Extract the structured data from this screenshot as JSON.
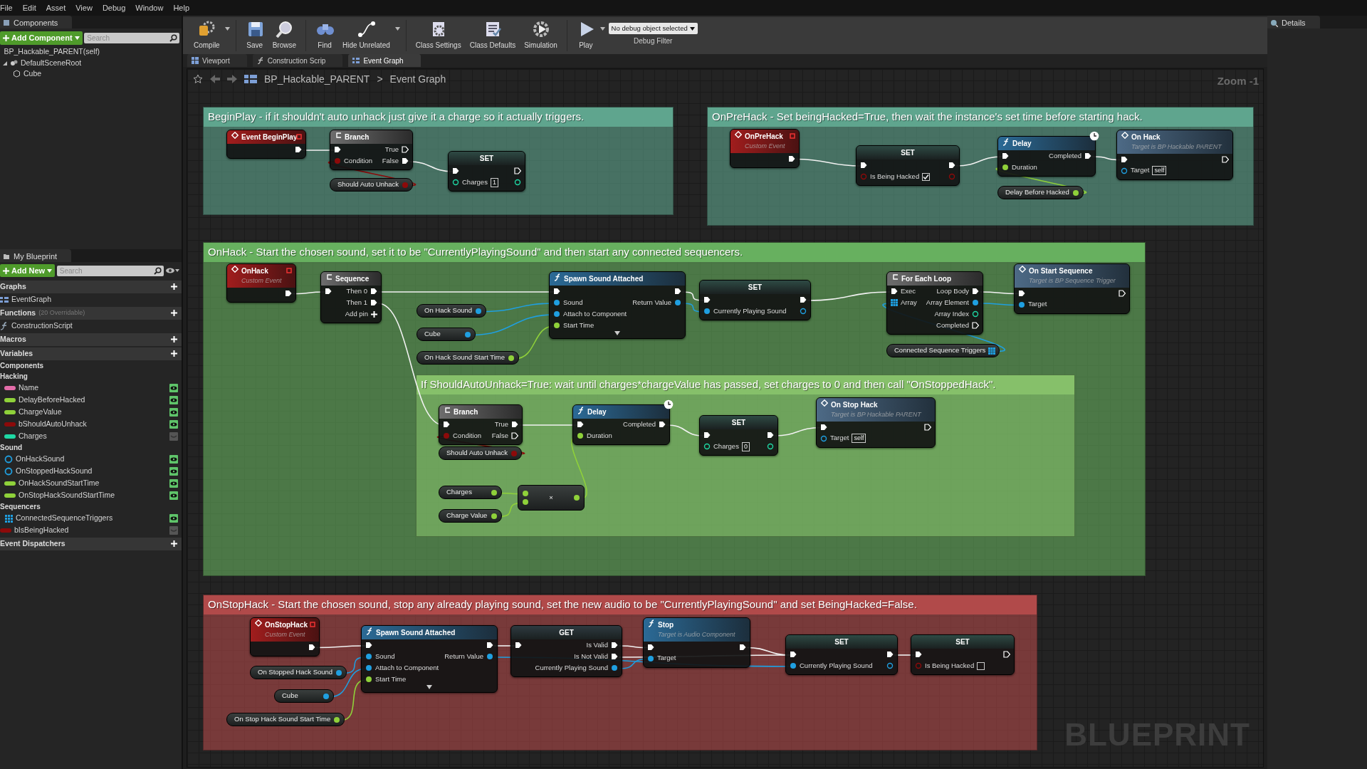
{
  "menu": [
    "File",
    "Edit",
    "Asset",
    "View",
    "Debug",
    "Window",
    "Help"
  ],
  "components_panel": {
    "tab": "Components",
    "add_button": "Add Component",
    "search": {
      "placeholder": "Search"
    },
    "root": "BP_Hackable_PARENT(self)",
    "tree": [
      {
        "label": "DefaultSceneRoot",
        "expanded": true,
        "children": [
          {
            "label": "Cube"
          }
        ]
      }
    ]
  },
  "my_blueprint": {
    "tab": "My Blueprint",
    "add_button": "Add New",
    "search": {
      "placeholder": "Search"
    },
    "sections": [
      {
        "title": "Graphs",
        "items": [
          {
            "kind": "graph",
            "label": "EventGraph"
          }
        ]
      },
      {
        "title": "Functions",
        "note": "(20 Overridable)",
        "items": [
          {
            "kind": "function",
            "label": "ConstructionScript"
          }
        ]
      },
      {
        "title": "Macros"
      },
      {
        "title": "Variables",
        "items": [
          {
            "kind": "category",
            "label": "Components"
          },
          {
            "kind": "category",
            "label": "Hacking",
            "children": [
              {
                "kind": "name",
                "label": "Name",
                "public": true
              },
              {
                "kind": "float",
                "label": "DelayBeforeHacked",
                "public": true
              },
              {
                "kind": "float",
                "label": "ChargeValue",
                "public": true
              },
              {
                "kind": "bool",
                "label": "bShouldAutoUnhack",
                "public": true
              },
              {
                "kind": "int",
                "label": "Charges",
                "public": false
              }
            ]
          },
          {
            "kind": "category",
            "label": "Sound",
            "children": [
              {
                "kind": "object",
                "label": "OnHackSound",
                "public": true
              },
              {
                "kind": "object",
                "label": "OnStoppedHackSound",
                "public": true
              },
              {
                "kind": "float",
                "label": "OnHackSoundStartTime",
                "public": true
              },
              {
                "kind": "float",
                "label": "OnStopHackSoundStartTime",
                "public": true
              }
            ]
          },
          {
            "kind": "category",
            "label": "Sequencers",
            "children": [
              {
                "kind": "array",
                "label": "ConnectedSequenceTriggers",
                "public": true
              }
            ]
          },
          {
            "kind": "bool",
            "label": "bIsBeingHacked",
            "public": false
          }
        ]
      },
      {
        "title": "Event Dispatchers"
      }
    ]
  },
  "toolbar": {
    "buttons": [
      {
        "label": "Compile",
        "dropdown": true
      },
      {
        "label": "Save"
      },
      {
        "label": "Browse"
      },
      {
        "label": "Find"
      },
      {
        "label": "Hide Unrelated",
        "dropdown": true
      },
      {
        "label": "Class Settings"
      },
      {
        "label": "Class Defaults"
      },
      {
        "label": "Simulation"
      },
      {
        "label": "Play",
        "dropdown": true
      }
    ],
    "debug_filter": {
      "value": "No debug object selected",
      "label": "Debug Filter"
    }
  },
  "tabs": [
    {
      "label": "Viewport",
      "selected": false
    },
    {
      "label": "Construction Scrip",
      "selected": false
    },
    {
      "label": "Event Graph",
      "selected": true
    }
  ],
  "breadcrumb": {
    "path": [
      "BP_Hackable_PARENT",
      "Event Graph"
    ],
    "separator": ">"
  },
  "zoom": "Zoom -1",
  "graph": {
    "comments": [
      {
        "title": "BeginPlay - if it shouldn't auto unhack just give it a charge so it actually triggers.",
        "color": "#5fa58e",
        "nodes": [
          {
            "kind": "event",
            "title": "Event BeginPlay",
            "outputs": [
              {
                "kind": "exec",
                "linked": true
              }
            ]
          },
          {
            "kind": "flow",
            "title": "Branch",
            "inputs": [
              {
                "kind": "exec",
                "linked": true
              },
              {
                "kind": "bool",
                "label": "Condition",
                "linked": true
              }
            ],
            "outputs": [
              {
                "kind": "exec",
                "label": "True",
                "linked": false
              },
              {
                "kind": "exec",
                "label": "False",
                "linked": true
              }
            ]
          },
          {
            "kind": "variable",
            "title": "Should Auto Unhack",
            "outputs": [
              {
                "kind": "bool",
                "linked": true
              }
            ]
          },
          {
            "kind": "set",
            "title": "SET",
            "inputs": [
              {
                "kind": "exec",
                "linked": true
              },
              {
                "kind": "int",
                "label": "Charges",
                "linked": false,
                "value": "1"
              }
            ],
            "outputs": [
              {
                "kind": "exec",
                "linked": false
              },
              {
                "kind": "int",
                "linked": false
              }
            ]
          }
        ]
      },
      {
        "title": "OnPreHack - Set beingHacked=True, then wait the instance's set time before starting hack.",
        "color": "#5fa58e",
        "nodes": [
          {
            "kind": "event",
            "title": "OnPreHack",
            "subtitle": "Custom Event",
            "outputs": [
              {
                "kind": "exec",
                "linked": true
              }
            ]
          },
          {
            "kind": "set",
            "title": "SET",
            "inputs": [
              {
                "kind": "exec",
                "linked": true
              },
              {
                "kind": "bool",
                "label": "Is Being Hacked",
                "linked": false,
                "checked": true
              }
            ],
            "outputs": [
              {
                "kind": "exec",
                "linked": true
              },
              {
                "kind": "bool",
                "linked": false
              }
            ]
          },
          {
            "kind": "function",
            "title": "Delay",
            "latent": true,
            "inputs": [
              {
                "kind": "exec",
                "linked": true
              },
              {
                "kind": "float",
                "label": "Duration",
                "linked": true
              }
            ],
            "outputs": [
              {
                "kind": "exec",
                "label": "Completed",
                "linked": true
              }
            ]
          },
          {
            "kind": "variable",
            "title": "Delay Before Hacked",
            "outputs": [
              {
                "kind": "float",
                "linked": true
              }
            ]
          },
          {
            "kind": "message",
            "title": "On Hack",
            "subtitle": "Target is BP Hackable PARENT",
            "inputs": [
              {
                "kind": "exec",
                "linked": true
              },
              {
                "kind": "object",
                "label": "Target",
                "linked": false,
                "value": "self"
              }
            ],
            "outputs": [
              {
                "kind": "exec",
                "linked": false
              }
            ]
          }
        ]
      },
      {
        "title": "OnHack - Start the chosen sound, set it to be \"CurrentlyPlayingSound\" and then start any connected sequencers.",
        "color": "#67b05f",
        "nodes": [
          {
            "kind": "event",
            "title": "OnHack",
            "subtitle": "Custom Event",
            "outputs": [
              {
                "kind": "exec",
                "linked": true
              }
            ]
          },
          {
            "kind": "flow",
            "title": "Sequence",
            "inputs": [
              {
                "kind": "exec",
                "linked": true
              }
            ],
            "outputs": [
              {
                "kind": "exec",
                "label": "Then 0",
                "linked": true
              },
              {
                "kind": "exec",
                "label": "Then 1",
                "linked": true
              },
              {
                "kind": "add",
                "label": "Add pin"
              }
            ]
          },
          {
            "kind": "variable",
            "title": "On Hack Sound",
            "outputs": [
              {
                "kind": "object",
                "linked": true
              }
            ]
          },
          {
            "kind": "variable",
            "title": "Cube",
            "outputs": [
              {
                "kind": "object",
                "linked": true
              }
            ]
          },
          {
            "kind": "variable",
            "title": "On Hack Sound Start Time",
            "outputs": [
              {
                "kind": "float",
                "linked": true
              }
            ]
          },
          {
            "kind": "function",
            "title": "Spawn Sound Attached",
            "advanced": true,
            "inputs": [
              {
                "kind": "exec",
                "linked": true
              },
              {
                "kind": "object",
                "label": "Sound",
                "linked": true
              },
              {
                "kind": "object",
                "label": "Attach to Component",
                "linked": true
              },
              {
                "kind": "float",
                "label": "Start Time",
                "linked": true
              }
            ],
            "outputs": [
              {
                "kind": "exec",
                "linked": true
              },
              {
                "kind": "object",
                "label": "Return Value",
                "linked": true
              }
            ]
          },
          {
            "kind": "set",
            "title": "SET",
            "inputs": [
              {
                "kind": "exec",
                "linked": true
              },
              {
                "kind": "object",
                "label": "Currently Playing Sound",
                "linked": true
              }
            ],
            "outputs": [
              {
                "kind": "exec",
                "linked": true
              },
              {
                "kind": "object",
                "linked": false
              }
            ]
          },
          {
            "kind": "flow",
            "title": "For Each Loop",
            "inputs": [
              {
                "kind": "exec",
                "label": "Exec",
                "linked": true
              },
              {
                "kind": "array",
                "label": "Array",
                "linked": true
              }
            ],
            "outputs": [
              {
                "kind": "exec",
                "label": "Loop Body",
                "linked": true
              },
              {
                "kind": "object",
                "label": "Array Element",
                "linked": true
              },
              {
                "kind": "int",
                "label": "Array Index",
                "linked": false
              },
              {
                "kind": "exec",
                "label": "Completed",
                "linked": false
              }
            ]
          },
          {
            "kind": "variable",
            "title": "Connected Sequence Triggers",
            "outputs": [
              {
                "kind": "array",
                "linked": true
              }
            ]
          },
          {
            "kind": "message",
            "title": "On Start Sequence",
            "subtitle": "Target is BP Sequence Trigger",
            "inputs": [
              {
                "kind": "exec",
                "linked": true
              },
              {
                "kind": "object",
                "label": "Target",
                "linked": true
              }
            ],
            "outputs": [
              {
                "kind": "exec",
                "linked": false
              }
            ]
          }
        ]
      },
      {
        "title": "If ShouldAutoUnhack=True: wait until charges*chargeValue has passed, set charges to 0 and then call \"OnStoppedHack\".",
        "color": "#86c06a",
        "nodes": [
          {
            "kind": "flow",
            "title": "Branch",
            "inputs": [
              {
                "kind": "exec",
                "linked": true
              },
              {
                "kind": "bool",
                "label": "Condition",
                "linked": true
              }
            ],
            "outputs": [
              {
                "kind": "exec",
                "label": "True",
                "linked": true
              },
              {
                "kind": "exec",
                "label": "False",
                "linked": false
              }
            ]
          },
          {
            "kind": "variable",
            "title": "Should Auto Unhack",
            "outputs": [
              {
                "kind": "bool",
                "linked": true
              }
            ]
          },
          {
            "kind": "function",
            "title": "Delay",
            "latent": true,
            "inputs": [
              {
                "kind": "exec",
                "linked": true
              },
              {
                "kind": "float",
                "label": "Duration",
                "linked": true
              }
            ],
            "outputs": [
              {
                "kind": "exec",
                "label": "Completed",
                "linked": true
              }
            ]
          },
          {
            "kind": "set",
            "title": "SET",
            "inputs": [
              {
                "kind": "exec",
                "linked": true
              },
              {
                "kind": "int",
                "label": "Charges",
                "linked": false,
                "value": "0"
              }
            ],
            "outputs": [
              {
                "kind": "exec",
                "linked": true
              },
              {
                "kind": "int",
                "linked": false
              }
            ]
          },
          {
            "kind": "message",
            "title": "On Stop Hack",
            "subtitle": "Target is BP Hackable PARENT",
            "inputs": [
              {
                "kind": "exec",
                "linked": true
              },
              {
                "kind": "object",
                "label": "Target",
                "linked": false,
                "value": "self"
              }
            ],
            "outputs": [
              {
                "kind": "exec",
                "linked": false
              }
            ]
          },
          {
            "kind": "variable",
            "title": "Charges",
            "outputs": [
              {
                "kind": "float",
                "linked": true
              }
            ]
          },
          {
            "kind": "variable",
            "title": "Charge Value",
            "outputs": [
              {
                "kind": "float",
                "linked": true
              }
            ]
          },
          {
            "kind": "math",
            "title": "×",
            "inputs": [
              {
                "kind": "float",
                "linked": true
              },
              {
                "kind": "float",
                "linked": true
              }
            ],
            "outputs": [
              {
                "kind": "float",
                "linked": true
              }
            ]
          }
        ]
      },
      {
        "title": "OnStopHack - Start the chosen sound, stop any already playing sound, set the new audio to  be \"CurrentlyPlayingSound\" and set BeingHacked=False.",
        "color": "#b14a4a",
        "nodes": [
          {
            "kind": "event",
            "title": "OnStopHack",
            "subtitle": "Custom Event",
            "outputs": [
              {
                "kind": "exec",
                "linked": true
              }
            ]
          },
          {
            "kind": "variable",
            "title": "On Stopped Hack Sound",
            "outputs": [
              {
                "kind": "object",
                "linked": true
              }
            ]
          },
          {
            "kind": "variable",
            "title": "Cube",
            "outputs": [
              {
                "kind": "object",
                "linked": true
              }
            ]
          },
          {
            "kind": "variable",
            "title": "On Stop Hack Sound Start Time",
            "outputs": [
              {
                "kind": "float",
                "linked": true
              }
            ]
          },
          {
            "kind": "function",
            "title": "Spawn Sound Attached",
            "advanced": true,
            "inputs": [
              {
                "kind": "exec",
                "linked": true
              },
              {
                "kind": "object",
                "label": "Sound",
                "linked": true
              },
              {
                "kind": "object",
                "label": "Attach to Component",
                "linked": true
              },
              {
                "kind": "float",
                "label": "Start Time",
                "linked": true
              }
            ],
            "outputs": [
              {
                "kind": "exec",
                "linked": true
              },
              {
                "kind": "object",
                "label": "Return Value",
                "linked": true
              }
            ]
          },
          {
            "kind": "get",
            "title": "GET",
            "inputs": [
              {
                "kind": "exec",
                "linked": true
              }
            ],
            "outputs": [
              {
                "kind": "exec",
                "label": "Is Valid",
                "linked": true
              },
              {
                "kind": "exec",
                "label": "Is Not Valid",
                "linked": true
              },
              {
                "kind": "object",
                "label": "Currently Playing Sound",
                "linked": true
              }
            ]
          },
          {
            "kind": "function",
            "title": "Stop",
            "subtitle": "Target is Audio Component",
            "inputs": [
              {
                "kind": "exec",
                "linked": true
              },
              {
                "kind": "object",
                "label": "Target",
                "linked": true
              }
            ],
            "outputs": [
              {
                "kind": "exec",
                "linked": true
              }
            ]
          },
          {
            "kind": "set",
            "title": "SET",
            "inputs": [
              {
                "kind": "exec",
                "linked": true
              },
              {
                "kind": "object",
                "label": "Currently Playing Sound",
                "linked": true
              }
            ],
            "outputs": [
              {
                "kind": "exec",
                "linked": true
              },
              {
                "kind": "object",
                "linked": false
              }
            ]
          },
          {
            "kind": "set",
            "title": "SET",
            "inputs": [
              {
                "kind": "exec",
                "linked": true
              },
              {
                "kind": "bool",
                "label": "Is Being Hacked",
                "linked": false,
                "checked": false
              }
            ],
            "outputs": [
              {
                "kind": "exec",
                "linked": false
              }
            ]
          }
        ]
      }
    ]
  },
  "graph_label": "BLUEPRINT",
  "details_panel": {
    "tab": "Details"
  }
}
